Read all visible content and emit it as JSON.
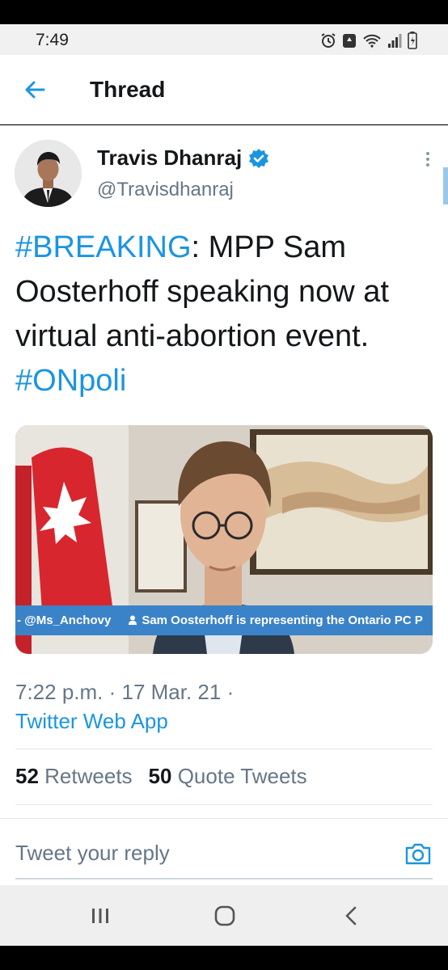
{
  "status_bar": {
    "time": "7:49",
    "icons": [
      "alarm-icon",
      "recycle-icon",
      "wifi-icon",
      "signal-icon",
      "battery-icon"
    ]
  },
  "header": {
    "title": "Thread",
    "back_icon": "back-arrow-icon"
  },
  "tweet": {
    "author_name": "Travis Dhanraj",
    "verified": true,
    "handle": "@Travisdhanraj",
    "text_parts": {
      "hashtag1": "#BREAKING",
      "body": ": MPP Sam Oosterhoff speaking now at virtual anti-abortion event. ",
      "hashtag2": "#ONpoli"
    },
    "media": {
      "lower_third_handle": "- @Ms_Anchovy",
      "lower_third_text": "Sam Oosterhoff is representing the Ontario PC P"
    },
    "timestamp": "7:22 p.m. · 17 Mar. 21 ·",
    "source": "Twitter Web App",
    "retweets_count": "52",
    "retweets_label": "Retweets",
    "quotes_count": "50",
    "quotes_label": "Quote Tweets"
  },
  "reply": {
    "placeholder": "Tweet your reply"
  },
  "colors": {
    "accent": "#1b95e0",
    "text": "#14171a",
    "secondary": "#657786",
    "lower_third": "#3b83c8"
  }
}
